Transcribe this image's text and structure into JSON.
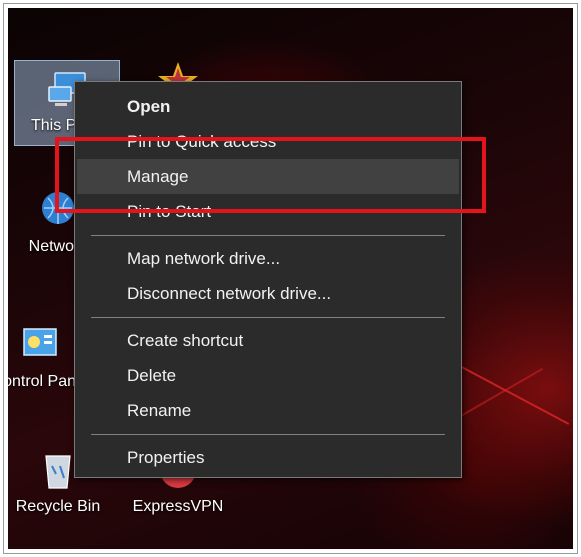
{
  "desktop": {
    "icons": [
      {
        "id": "this-pc",
        "label": "This PC"
      },
      {
        "id": "network",
        "label": "Network"
      },
      {
        "id": "control-panel",
        "label": "Control Panel"
      },
      {
        "id": "recycle-bin",
        "label": "Recycle Bin"
      },
      {
        "id": "expressvpn",
        "label": "ExpressVPN"
      }
    ]
  },
  "context_menu": {
    "items": [
      {
        "label": "Open",
        "bold": true
      },
      {
        "label": "Pin to Quick access"
      },
      {
        "label": "Manage",
        "hovered": true
      },
      {
        "label": "Pin to Start"
      },
      {
        "label": "Map network drive..."
      },
      {
        "label": "Disconnect network drive..."
      },
      {
        "label": "Create shortcut"
      },
      {
        "label": "Delete"
      },
      {
        "label": "Rename"
      },
      {
        "label": "Properties"
      }
    ]
  },
  "annotation": {
    "highlight_color": "#e3141b"
  },
  "colors": {
    "menu_bg": "#2b2b2b",
    "menu_hover": "#414141",
    "menu_text": "#f2f2f2"
  }
}
